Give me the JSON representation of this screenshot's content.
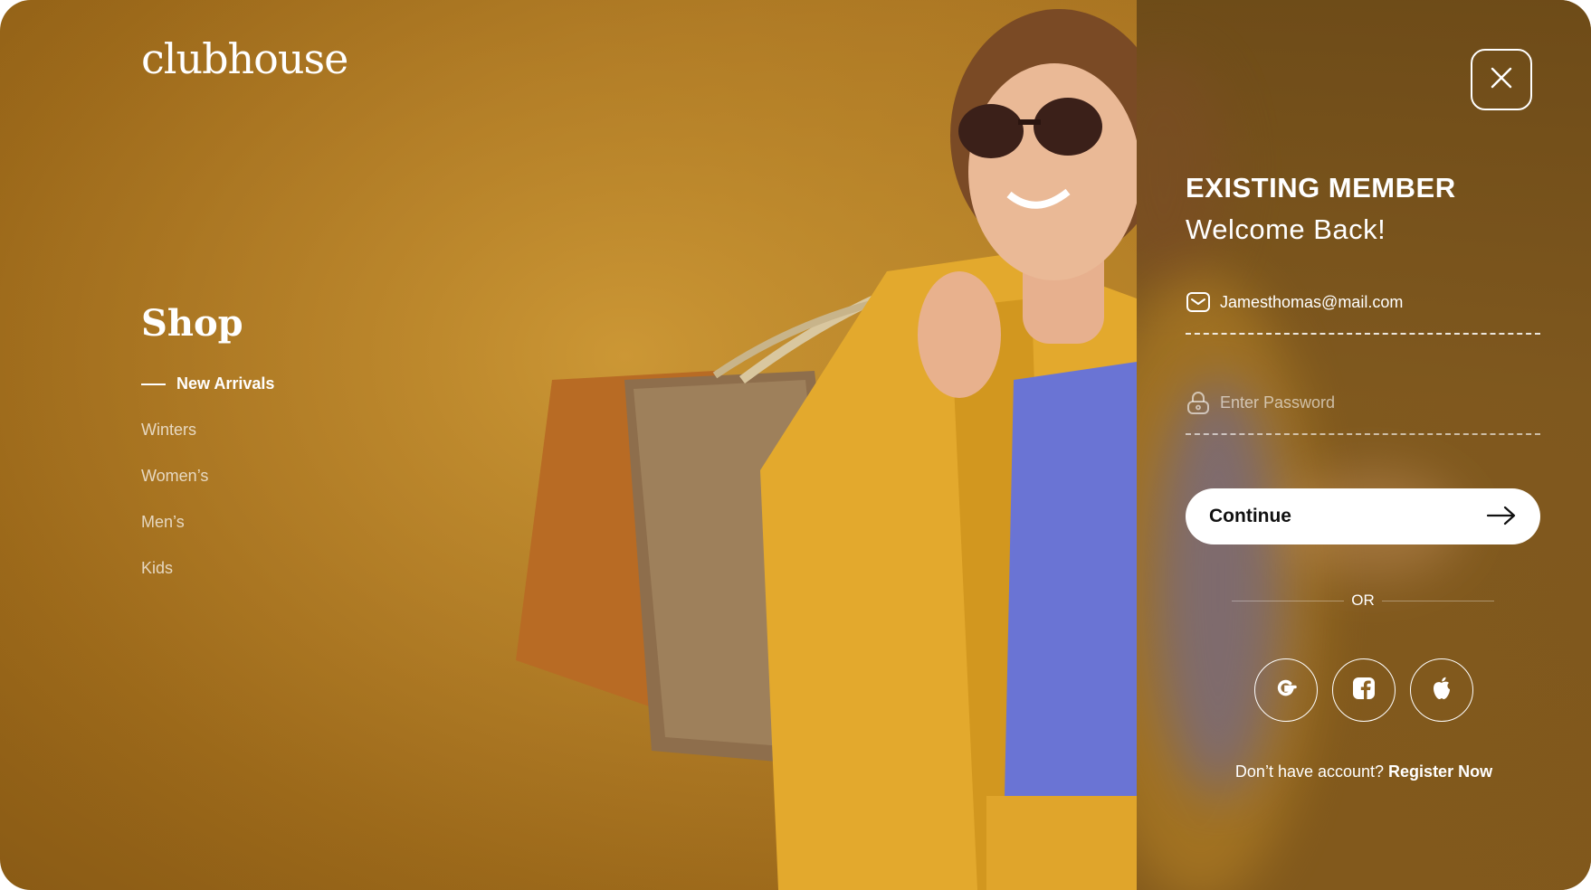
{
  "brand": {
    "logo_text": "clubhouse"
  },
  "nav": {
    "title": "Shop",
    "items": [
      {
        "label": "New Arrivals",
        "active": true
      },
      {
        "label": "Winters",
        "active": false
      },
      {
        "label": "Women’s",
        "active": false
      },
      {
        "label": "Men’s",
        "active": false
      },
      {
        "label": "Kids",
        "active": false
      }
    ]
  },
  "login": {
    "heading": "EXISTING MEMBER",
    "subheading": "Welcome Back!",
    "email": {
      "value": "Jamesthomas@mail.com",
      "icon": "mail-icon"
    },
    "password": {
      "value": "",
      "placeholder": "Enter Password",
      "icon": "lock-icon"
    },
    "continue_label": "Continue",
    "or_label": "OR",
    "socials": [
      {
        "name": "google",
        "icon": "google-icon"
      },
      {
        "name": "facebook",
        "icon": "facebook-icon"
      },
      {
        "name": "apple",
        "icon": "apple-icon"
      }
    ],
    "register_prompt": "Don’t have account?",
    "register_link": "Register Now"
  },
  "colors": {
    "background": "#b07a25",
    "panel": "#7c561e",
    "text": "#ffffff",
    "button_bg": "#ffffff",
    "button_text": "#111111"
  }
}
